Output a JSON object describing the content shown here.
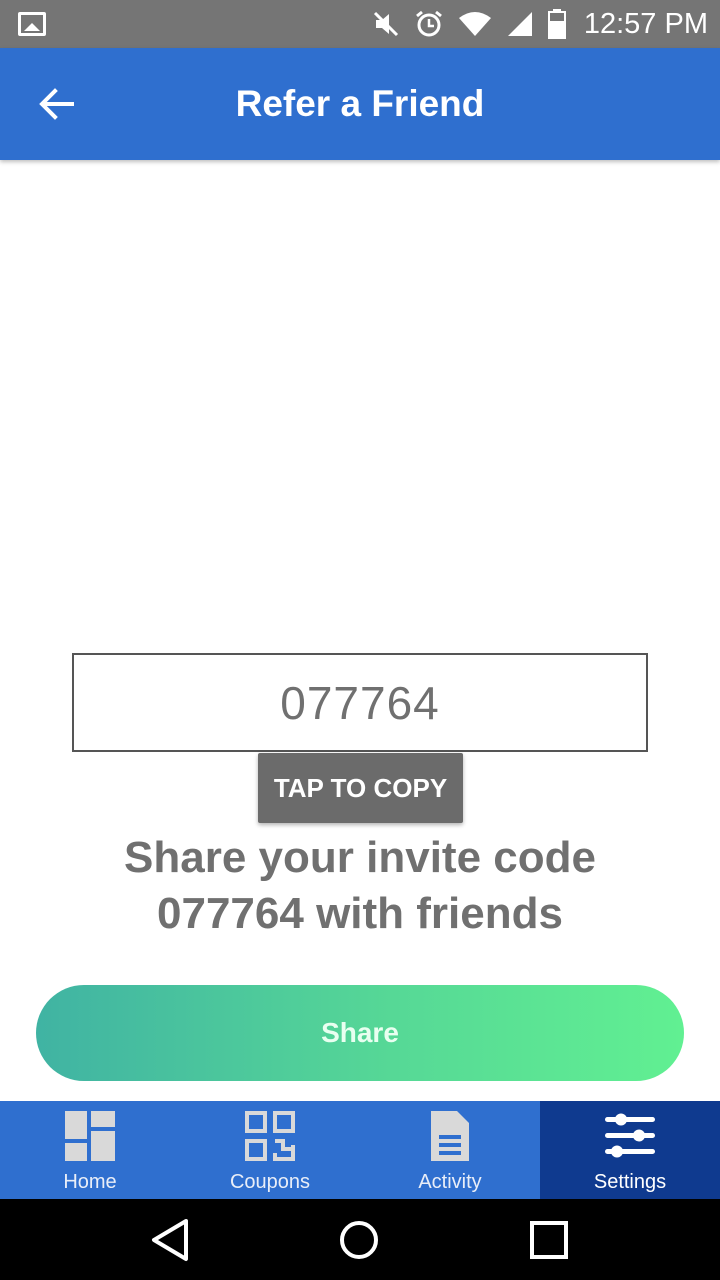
{
  "status_bar": {
    "time": "12:57 PM",
    "icons": [
      "image-notification-icon",
      "mute-icon",
      "alarm-icon",
      "wifi-icon",
      "signal-icon",
      "battery-icon"
    ]
  },
  "app_bar": {
    "title": "Refer a Friend",
    "back_icon": "back-arrow-icon"
  },
  "invite": {
    "code": "077764",
    "copy_label": "TAP TO COPY",
    "share_text_line1": "Share your invite code",
    "share_text_line2": "077764 with friends",
    "share_label": "Share"
  },
  "bottom_nav": {
    "items": [
      {
        "label": "Home",
        "icon": "dashboard-icon",
        "active": false
      },
      {
        "label": "Coupons",
        "icon": "qr-code-icon",
        "active": false
      },
      {
        "label": "Activity",
        "icon": "document-icon",
        "active": false
      },
      {
        "label": "Settings",
        "icon": "sliders-icon",
        "active": true
      }
    ]
  },
  "system_nav": {
    "icons": [
      "back-triangle-icon",
      "home-circle-icon",
      "recents-square-icon"
    ]
  },
  "colors": {
    "status_bar": "#757575",
    "app_bar": "#2f6fcf",
    "nav_active": "#0f3a8f",
    "share_gradient_start": "#40b3a3",
    "share_gradient_end": "#61f092",
    "text_gray": "#707070"
  }
}
